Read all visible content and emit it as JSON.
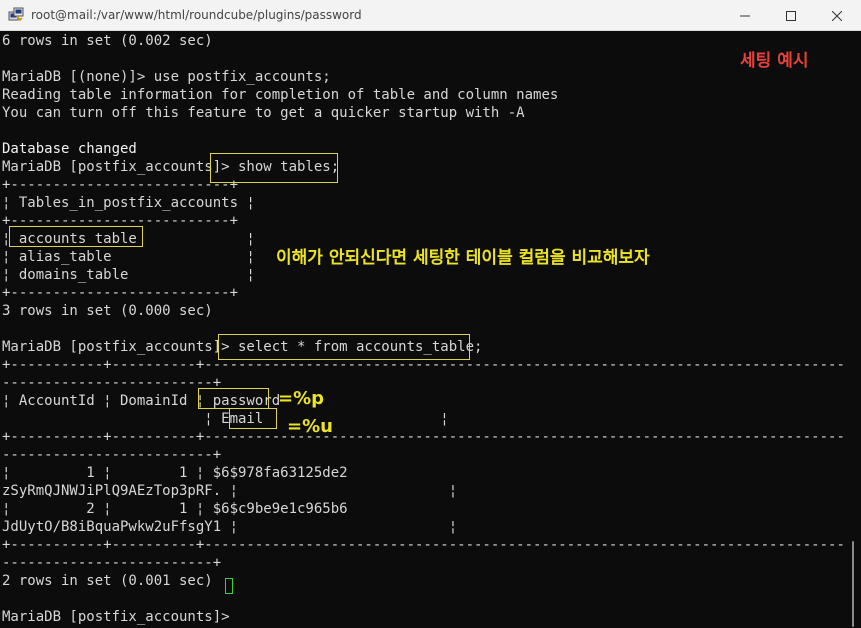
{
  "window": {
    "title": "root@mail:/var/www/html/roundcube/plugins/password",
    "icons": {
      "app": "putty-icon",
      "minimize": "minimize-icon",
      "maximize": "maximize-icon",
      "close": "close-icon"
    }
  },
  "terminal": {
    "lines": [
      "6 rows in set (0.002 sec)",
      "",
      "MariaDB [(none)]> use postfix_accounts;",
      "Reading table information for completion of table and column names",
      "You can turn off this feature to get a quicker startup with -A",
      "",
      "Database changed",
      "MariaDB [postfix_accounts]> show tables;",
      "+--------------------------+",
      "¦ Tables_in_postfix_accounts ¦",
      "+--------------------------+",
      "¦ accounts_table             ¦",
      "¦ alias_table                ¦",
      "¦ domains_table              ¦",
      "+--------------------------+",
      "3 rows in set (0.000 sec)",
      "",
      "MariaDB [postfix_accounts]> select * from accounts_table;",
      "+-----------+----------+-----------------------------------------------------------------------------------------------------------",
      "-------------------------+",
      "¦ AccountId ¦ DomainId ¦ password                 ",
      "                        ¦ Email                     ¦",
      "+-----------+----------+-----------------------------------------------------------------------------------------------------------",
      "-------------------------+",
      "¦         1 ¦        1 ¦ $6$978fa63125de2                                                                                  ɔEJH",
      "zSyRmQJNWJiPlQ9AEzTop3pRF. ¦                         ¦",
      "¦         2 ¦        1 ¦ $6$c9be9e1c965b6                                                                                  qIbR",
      "JdUytO/B8iBquaPwkw2uFfsgY1 ¦                         ¦",
      "+-----------+----------+-----------------------------------------------------------------------------------------------------------",
      "-------------------------+",
      "2 rows in set (0.001 sec)",
      "",
      "MariaDB [postfix_accounts]> "
    ]
  },
  "annotations": {
    "example_label": "세팅 예시",
    "compare_note": "이해가 안되신다면 세팅한 테이블 컬럼을 비교해보자",
    "password_mark": "=%p",
    "email_mark": "=%u"
  }
}
